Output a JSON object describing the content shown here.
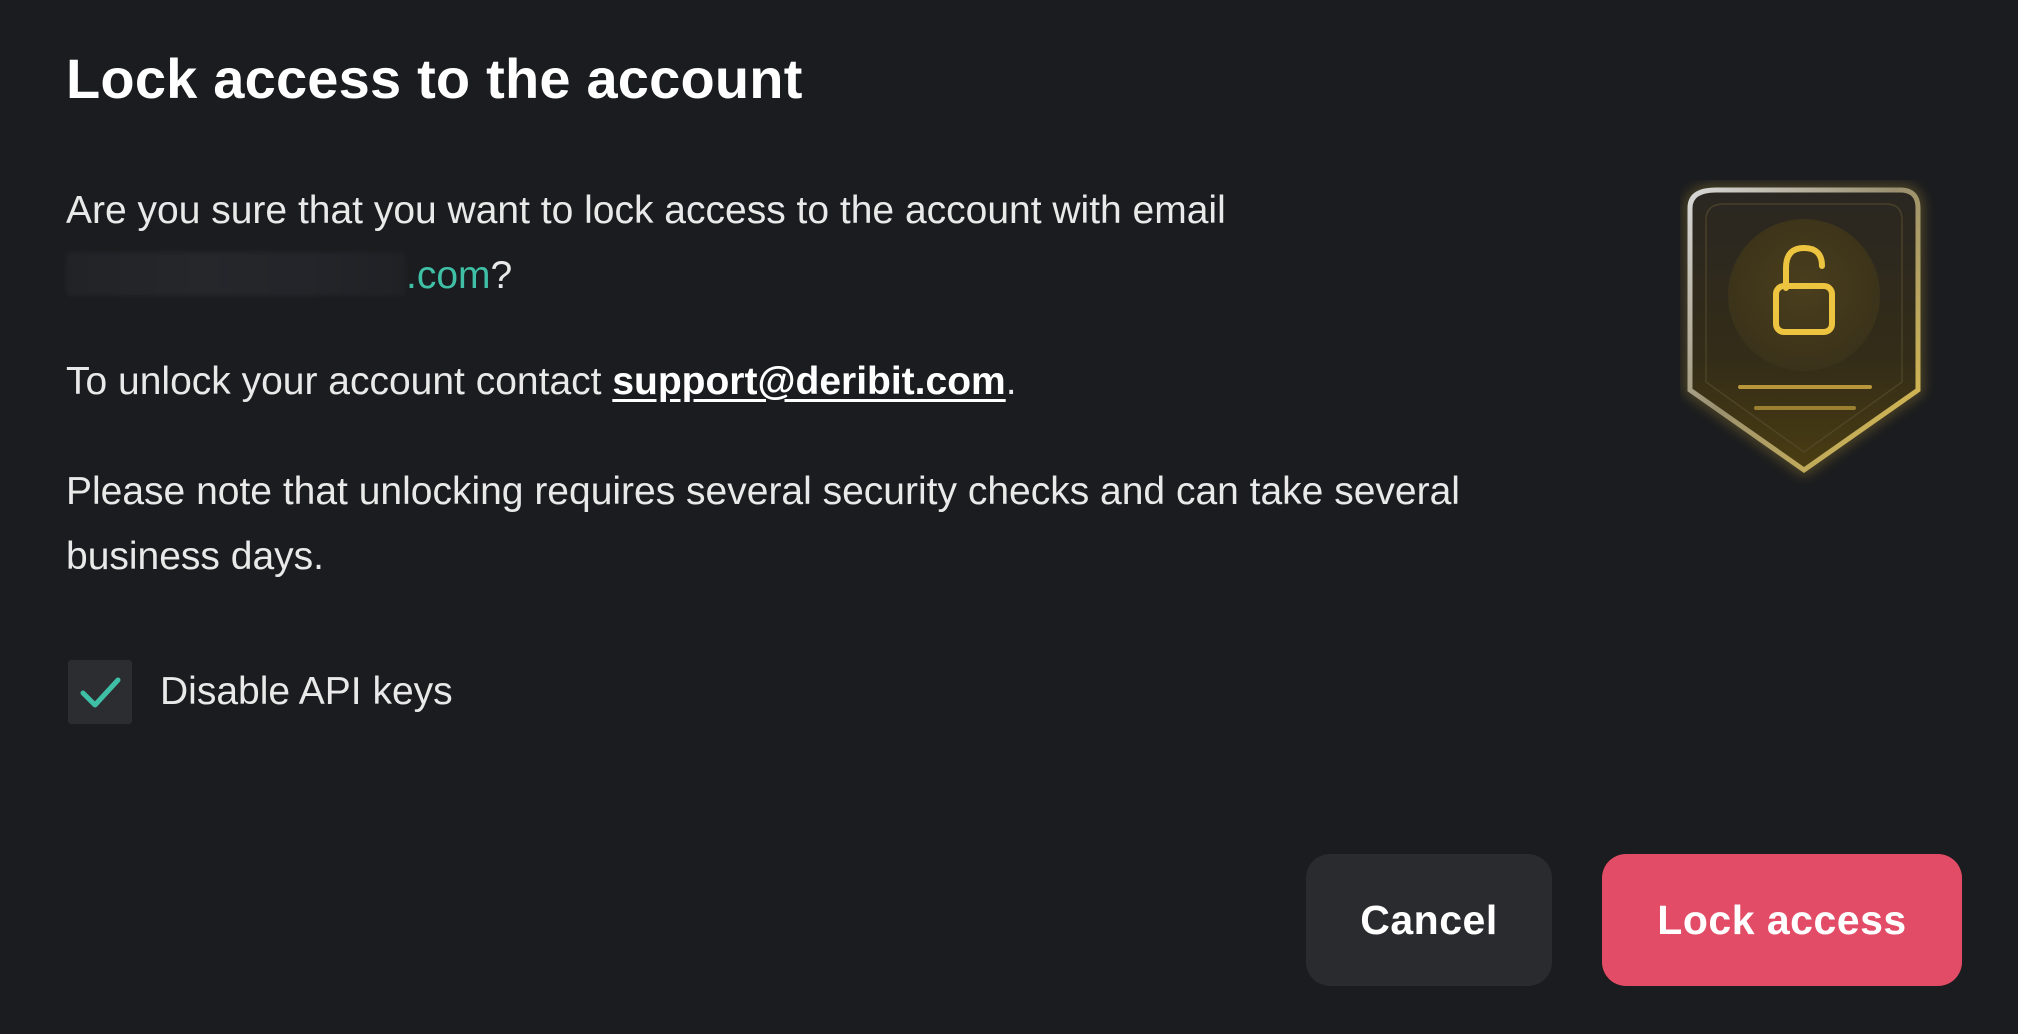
{
  "dialog": {
    "title": "Lock access to the account",
    "confirm_text": "Are you sure that you want to lock access to the account with email",
    "email_domain": ".com",
    "confirm_suffix": "?",
    "unlock_text": "To unlock your account contact",
    "support_email": "support@deribit.com",
    "unlock_suffix": ".",
    "note_text": "Please note that unlocking requires several security checks and can take several business days.",
    "checkbox": {
      "label": "Disable API keys",
      "checked": true
    },
    "buttons": {
      "cancel_label": "Cancel",
      "lock_label": "Lock access"
    },
    "icons": {
      "badge": "unlocked-padlock-shield-icon",
      "checkmark": "checkmark-icon"
    }
  },
  "colors": {
    "background": "#1b1c1f",
    "accent_teal": "#3fbfa5",
    "danger": "#e34c67",
    "secondary_button": "#2a2b2f",
    "gold": "#e8c24a"
  }
}
